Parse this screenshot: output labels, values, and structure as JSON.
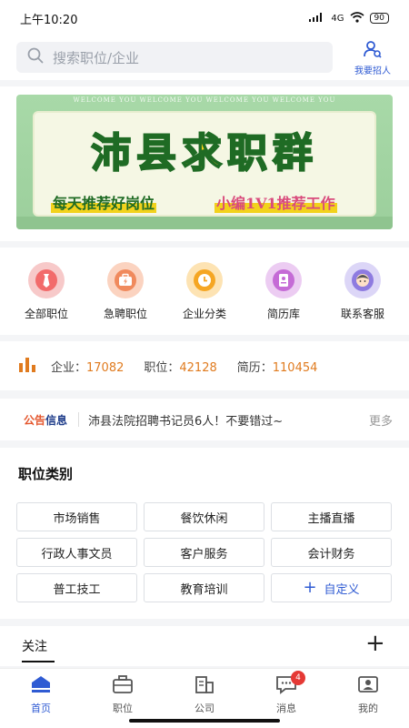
{
  "status_bar": {
    "time": "上午10:20",
    "signal": "4G",
    "battery": "90"
  },
  "search": {
    "placeholder": "搜索职位/企业",
    "hire_label": "我要招人"
  },
  "banner": {
    "welcome": "WELCOME YOU WELCOME YOU WELCOME YOU WELCOME YOU",
    "title": "沛县求职群",
    "subtitle_left": "每天推荐好岗位",
    "subtitle_right": "小编1V1推荐工作"
  },
  "quick_menu": [
    {
      "label": "全部职位",
      "icon": "tie-icon",
      "color": "#f26b6b"
    },
    {
      "label": "急聘职位",
      "icon": "briefcase-bolt-icon",
      "color": "#f08a5d"
    },
    {
      "label": "企业分类",
      "icon": "clock-icon",
      "color": "#f5a623"
    },
    {
      "label": "简历库",
      "icon": "resume-icon",
      "color": "#c56bd6"
    },
    {
      "label": "联系客服",
      "icon": "service-avatar-icon",
      "color": "#8e7be0"
    }
  ],
  "stats": {
    "company_label": "企业：",
    "company_value": "17082",
    "job_label": "职位：",
    "job_value": "42128",
    "resume_label": "简历：",
    "resume_value": "110454"
  },
  "notice": {
    "tag_a": "公告",
    "tag_b": "信息",
    "text": "沛县法院招聘书记员6人！不要错过~",
    "more": "更多"
  },
  "categories": {
    "title": "职位类别",
    "items": [
      "市场销售",
      "餐饮休闲",
      "主播直播",
      "行政人事文员",
      "客户服务",
      "会计财务",
      "普工技工",
      "教育培训"
    ],
    "custom_label": "自定义"
  },
  "follow": {
    "label": "关注"
  },
  "tabbar": {
    "items": [
      {
        "label": "首页",
        "active": true
      },
      {
        "label": "职位",
        "active": false
      },
      {
        "label": "公司",
        "active": false
      },
      {
        "label": "消息",
        "active": false,
        "badge": "4"
      },
      {
        "label": "我的",
        "active": false
      }
    ]
  },
  "colors": {
    "accent": "#2f5bd3",
    "stat_value": "#e07b1f",
    "badge": "#e53935"
  }
}
